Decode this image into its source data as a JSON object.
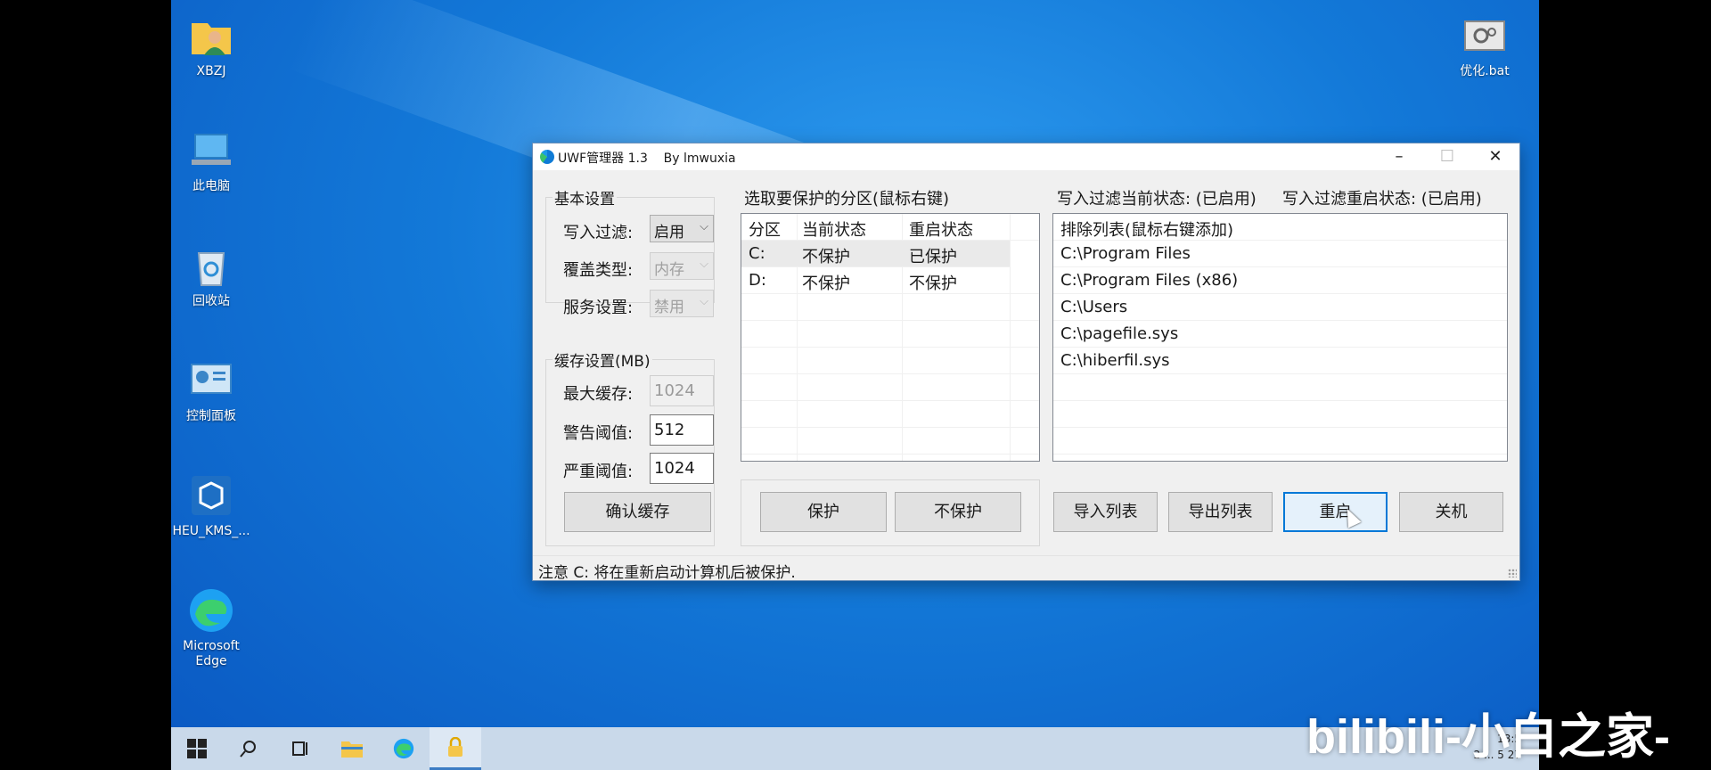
{
  "desktop": {
    "icons": [
      {
        "label": "XBZJ",
        "icon": "user-folder-icon"
      },
      {
        "label": "此电脑",
        "icon": "this-pc-icon"
      },
      {
        "label": "回收站",
        "icon": "recycle-bin-icon"
      },
      {
        "label": "控制面板",
        "icon": "control-panel-icon"
      },
      {
        "label": "HEU_KMS_...",
        "icon": "heu-kms-icon"
      },
      {
        "label": "Microsoft Edge",
        "icon": "edge-icon"
      },
      {
        "label": "优化.bat",
        "icon": "bat-file-icon"
      }
    ]
  },
  "window": {
    "title": "UWF管理器 1.3    By lmwuxia",
    "controls": {
      "minimize": "–",
      "maximize": "☐",
      "close": "✕"
    },
    "basic": {
      "title": "基本设置",
      "write_filter_label": "写入过滤:",
      "write_filter_value": "启用",
      "overlay_type_label": "覆盖类型:",
      "overlay_type_value": "内存",
      "service_label": "服务设置:",
      "service_value": "禁用"
    },
    "cache": {
      "title": "缓存设置(MB)",
      "max_label": "最大缓存:",
      "max_value": "1024",
      "warn_label": "警告阈值:",
      "warn_value": "512",
      "critical_label": "严重阈值:",
      "critical_value": "1024",
      "confirm_button": "确认缓存"
    },
    "partitions": {
      "title": "选取要保护的分区(鼠标右键)",
      "columns": [
        "分区",
        "当前状态",
        "重启状态"
      ],
      "rows": [
        [
          "C:",
          "不保护",
          "已保护"
        ],
        [
          "D:",
          "不保护",
          "不保护"
        ]
      ],
      "protect_button": "保护",
      "unprotect_button": "不保护"
    },
    "filter_status": {
      "current": "写入过滤当前状态: (已启用)",
      "reboot": "写入过滤重启状态: (已启用)"
    },
    "exclusions": {
      "header": "排除列表(鼠标右键添加)",
      "items": [
        "C:\\Program Files",
        "C:\\Program Files (x86)",
        "C:\\Users",
        "C:\\pagefile.sys",
        "C:\\hiberfil.sys"
      ]
    },
    "actions": {
      "import": "导入列表",
      "export": "导出列表",
      "restart": "重启",
      "shutdown": "关机"
    },
    "status": "注意 C: 将在重新启动计算机后被保护."
  },
  "taskbar": {
    "items": [
      "start-icon",
      "search-icon",
      "task-view-icon",
      "file-explorer-icon",
      "edge-icon",
      "uwf-lock-icon"
    ],
    "tray_time": "18:5",
    "tray_date": "2 ... 5 27"
  },
  "watermark": "bilibili-小白之家-"
}
